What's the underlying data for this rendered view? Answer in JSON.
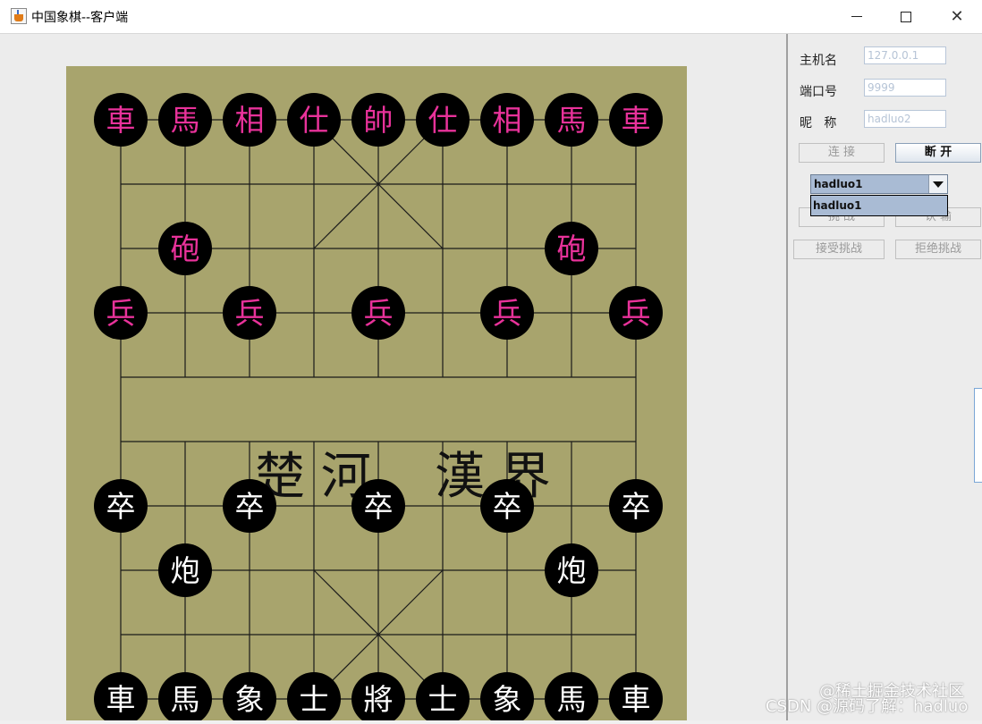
{
  "window": {
    "title": "中国象棋--客户端",
    "icon": "java-cup-icon",
    "controls": [
      "minimize-icon",
      "maximize-icon",
      "close-icon"
    ]
  },
  "board": {
    "background": "#a8a46d",
    "river_left": "楚 河",
    "river_right": "漢 界",
    "top_color": "#e8329a",
    "bottom_color": "#ffffff",
    "top_pieces": [
      {
        "char": "車",
        "col": 0,
        "row": 0
      },
      {
        "char": "馬",
        "col": 1,
        "row": 0
      },
      {
        "char": "相",
        "col": 2,
        "row": 0
      },
      {
        "char": "仕",
        "col": 3,
        "row": 0
      },
      {
        "char": "帥",
        "col": 4,
        "row": 0
      },
      {
        "char": "仕",
        "col": 5,
        "row": 0
      },
      {
        "char": "相",
        "col": 6,
        "row": 0
      },
      {
        "char": "馬",
        "col": 7,
        "row": 0
      },
      {
        "char": "車",
        "col": 8,
        "row": 0
      },
      {
        "char": "砲",
        "col": 1,
        "row": 2
      },
      {
        "char": "砲",
        "col": 7,
        "row": 2
      },
      {
        "char": "兵",
        "col": 0,
        "row": 3
      },
      {
        "char": "兵",
        "col": 2,
        "row": 3
      },
      {
        "char": "兵",
        "col": 4,
        "row": 3
      },
      {
        "char": "兵",
        "col": 6,
        "row": 3
      },
      {
        "char": "兵",
        "col": 8,
        "row": 3
      }
    ],
    "bottom_pieces": [
      {
        "char": "卒",
        "col": 0,
        "row": 6
      },
      {
        "char": "卒",
        "col": 2,
        "row": 6
      },
      {
        "char": "卒",
        "col": 4,
        "row": 6
      },
      {
        "char": "卒",
        "col": 6,
        "row": 6
      },
      {
        "char": "卒",
        "col": 8,
        "row": 6
      },
      {
        "char": "炮",
        "col": 1,
        "row": 7
      },
      {
        "char": "炮",
        "col": 7,
        "row": 7
      },
      {
        "char": "車",
        "col": 0,
        "row": 9
      },
      {
        "char": "馬",
        "col": 1,
        "row": 9
      },
      {
        "char": "象",
        "col": 2,
        "row": 9
      },
      {
        "char": "士",
        "col": 3,
        "row": 9
      },
      {
        "char": "將",
        "col": 4,
        "row": 9
      },
      {
        "char": "士",
        "col": 5,
        "row": 9
      },
      {
        "char": "象",
        "col": 6,
        "row": 9
      },
      {
        "char": "馬",
        "col": 7,
        "row": 9
      },
      {
        "char": "車",
        "col": 8,
        "row": 9
      }
    ]
  },
  "side_panel": {
    "host_label": "主机名",
    "host_value": "127.0.0.1",
    "port_label": "端口号",
    "port_value": "9999",
    "nick_label": "昵   称",
    "nick_value": "hadluo2",
    "connect_button": "连 接",
    "disconnect_button": "断 开",
    "opponent_selected": "hadluo1",
    "opponent_options": [
      "hadluo1"
    ],
    "challenge_button": "挑 战",
    "concede_button": "认 输",
    "accept_button": "接受挑战",
    "reject_button": "拒绝挑战"
  },
  "watermark": {
    "line1": "@稀土掘金技术社区",
    "line2": "CSDN @源码了解：hadluo"
  }
}
